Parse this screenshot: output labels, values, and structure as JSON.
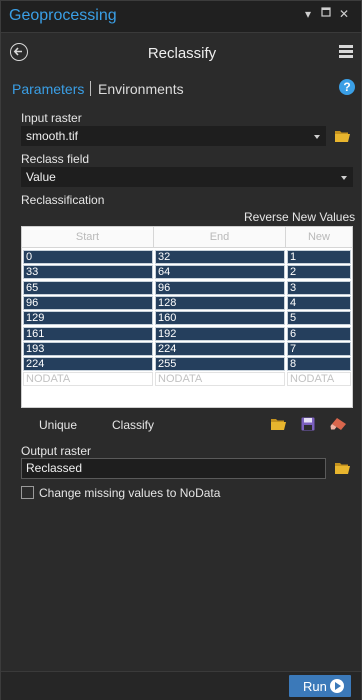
{
  "window": {
    "title": "Geoprocessing",
    "controls": {
      "dropdown": "▾",
      "pin": "🗕",
      "close": "✕"
    }
  },
  "tool": {
    "title": "Reclassify"
  },
  "tabs": [
    {
      "label": "Parameters",
      "active": true
    },
    {
      "label": "Environments",
      "active": false
    }
  ],
  "params": {
    "input_raster": {
      "label": "Input raster",
      "value": "smooth.tif"
    },
    "reclass_field": {
      "label": "Reclass field",
      "value": "Value"
    },
    "reclassification": {
      "label": "Reclassification",
      "reverse_label": "Reverse New Values",
      "columns": [
        "Start",
        "End",
        "New"
      ],
      "rows": [
        [
          "0",
          "32",
          "1"
        ],
        [
          "33",
          "64",
          "2"
        ],
        [
          "65",
          "96",
          "3"
        ],
        [
          "96",
          "128",
          "4"
        ],
        [
          "129",
          "160",
          "5"
        ],
        [
          "161",
          "192",
          "6"
        ],
        [
          "193",
          "224",
          "7"
        ],
        [
          "224",
          "255",
          "8"
        ],
        [
          "NODATA",
          "NODATA",
          "NODATA"
        ]
      ],
      "buttons": {
        "unique": "Unique",
        "classify": "Classify"
      }
    },
    "output_raster": {
      "label": "Output raster",
      "value": "Reclassed"
    },
    "nodata_check": {
      "label": "Change missing values to NoData",
      "checked": false
    }
  },
  "footer": {
    "run_label": "Run"
  },
  "icons": {
    "back": "back-arrow-icon",
    "menu": "hamburger-menu-icon",
    "help": "help-icon",
    "folder": "folder-icon",
    "save": "save-icon",
    "erase": "eraser-icon",
    "play": "play-icon"
  },
  "colors": {
    "accent": "#3a9fe6",
    "selected_row": "#253f5d",
    "run_button": "#3b79b9",
    "folder": "#e8b52e",
    "save": "#7a5fbd",
    "eraser": "#d9664c"
  }
}
